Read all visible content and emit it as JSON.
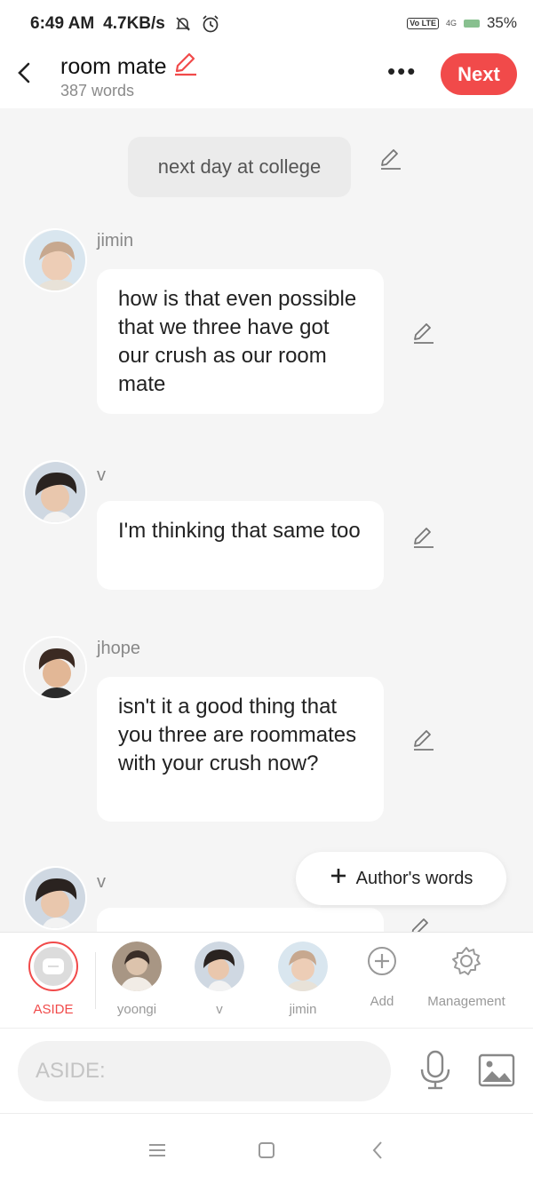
{
  "status": {
    "time": "6:49 AM",
    "speed": "4.7KB/s",
    "volte": "Vo LTE",
    "network": "4G",
    "battery": "35%"
  },
  "header": {
    "title": "room mate",
    "word_count": "387 words",
    "next_label": "Next"
  },
  "chat": {
    "aside_text": "next day at college",
    "messages": [
      {
        "name": "jimin",
        "text": "how is that even possible that we three have got our crush as our room mate"
      },
      {
        "name": "v",
        "text": "I'm thinking that same too"
      },
      {
        "name": "jhope",
        "text": "isn't it a good thing that you three are roommates with your crush now?"
      },
      {
        "name": "v",
        "text": ""
      }
    ],
    "authors_words_label": "Author's words"
  },
  "roles": {
    "aside_label": "ASIDE",
    "characters": [
      {
        "name": "yoongi"
      },
      {
        "name": "v"
      },
      {
        "name": "jimin"
      }
    ],
    "add_label": "Add",
    "management_label": "Management"
  },
  "input": {
    "placeholder": "ASIDE:"
  },
  "colors": {
    "accent": "#f14a4a",
    "background": "#f5f5f5"
  }
}
